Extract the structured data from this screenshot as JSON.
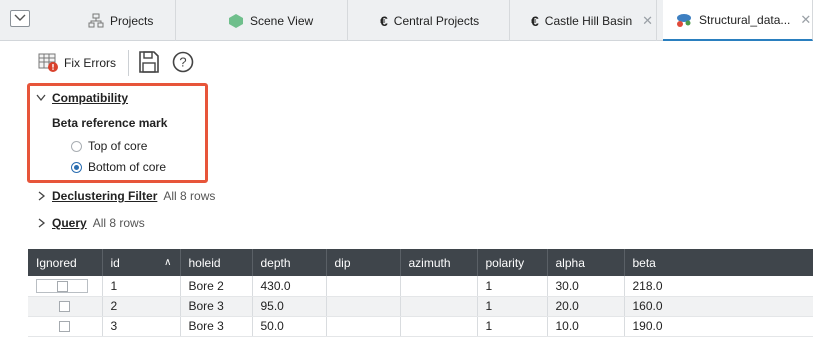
{
  "tabs": [
    {
      "label": "Projects",
      "icon": "projects-icon"
    },
    {
      "label": "Scene View",
      "icon": "scene-view-icon"
    },
    {
      "label": "Central Projects",
      "icon": "central-icon"
    },
    {
      "label": "Castle Hill Basin",
      "icon": "central-icon"
    },
    {
      "label": "Structural_data...",
      "icon": "structural-data-icon"
    }
  ],
  "toolbar": {
    "fix_errors_label": "Fix Errors"
  },
  "compatibility": {
    "title": "Compatibility",
    "subheading": "Beta reference mark",
    "options": [
      {
        "label": "Top of core",
        "checked": false
      },
      {
        "label": "Bottom of core",
        "checked": true
      }
    ]
  },
  "declustering": {
    "title": "Declustering Filter",
    "summary": "All 8 rows"
  },
  "query": {
    "title": "Query",
    "summary": "All 8 rows"
  },
  "table": {
    "columns": [
      "Ignored",
      "id",
      "holeid",
      "depth",
      "dip",
      "azimuth",
      "polarity",
      "alpha",
      "beta"
    ],
    "rows": [
      {
        "id": "1",
        "holeid": "Bore 2",
        "depth": "430.0",
        "dip": "",
        "azimuth": "",
        "polarity": "1",
        "alpha": "30.0",
        "beta": "218.0"
      },
      {
        "id": "2",
        "holeid": "Bore 3",
        "depth": "95.0",
        "dip": "",
        "azimuth": "",
        "polarity": "1",
        "alpha": "20.0",
        "beta": "160.0"
      },
      {
        "id": "3",
        "holeid": "Bore 3",
        "depth": "50.0",
        "dip": "",
        "azimuth": "",
        "polarity": "1",
        "alpha": "10.0",
        "beta": "190.0"
      }
    ]
  },
  "colors": {
    "highlight": "#e7553a",
    "header_bg": "#3f454b",
    "active_tab_accent": "#2a7fbf"
  }
}
